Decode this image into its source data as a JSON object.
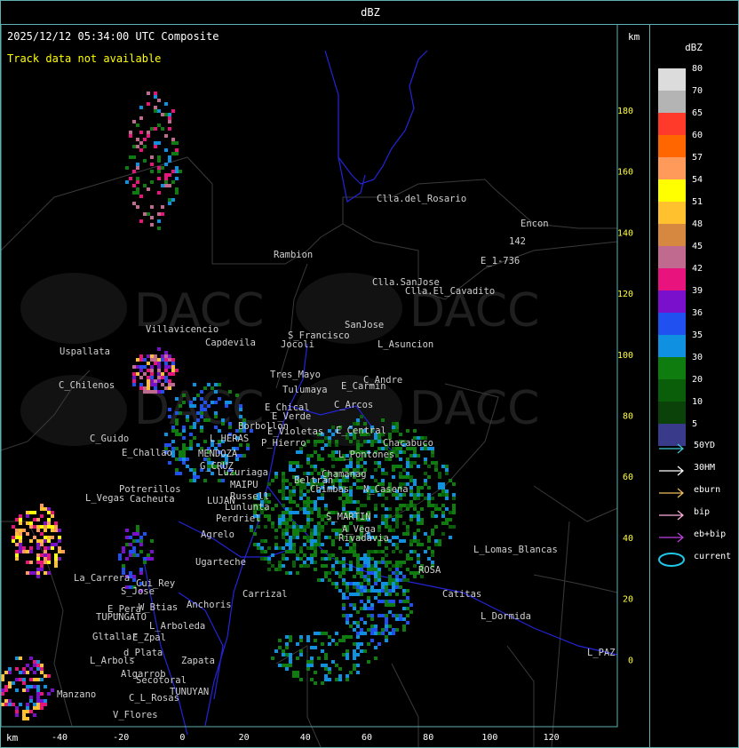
{
  "header": {
    "title": "dBZ"
  },
  "map": {
    "timestamp": "2025/12/12 05:34:00 UTC Composite",
    "track_status": "Track data not available",
    "unit_top": "km",
    "unit_bottom": "km",
    "y_ticks": [
      "180",
      "160",
      "140",
      "120",
      "100",
      "80",
      "60",
      "40",
      "20",
      "0"
    ],
    "x_ticks": [
      "-40",
      "-20",
      "0",
      "20",
      "40",
      "60",
      "80",
      "100",
      "120"
    ],
    "watermark": "DACC",
    "places": [
      "Clla.del_Rosario",
      "Encon",
      "142",
      "E_1-736",
      "Rambion",
      "Clla.SanJose",
      "Clla.El_Cavadito",
      "S_Francisco",
      "SanJose",
      "L_Asuncion",
      "Villavicencio",
      "Capdevila",
      "Uspallata",
      "Jocoli",
      "Tres_Mayo",
      "Tulumaya",
      "C_Andre",
      "E_Carmin",
      "C_Chilenos",
      "E_Chical",
      "E_Verde",
      "C_Arcos",
      "E_Violetas",
      "E_Central",
      "Borbollon",
      "P_Hierro",
      "L_HERAS",
      "C_Guido",
      "E_Challao",
      "MENDOZA",
      "G_CRUZ",
      "Luzuriaga",
      "Beltran",
      "Chimbas",
      "Chamanag",
      "L_Pontones",
      "Chacabuco",
      "MAIPU",
      "Russell",
      "Potrerillos",
      "L_Vegas",
      "Cacheuta",
      "LUJAN",
      "Lunlunta",
      "N_Casena",
      "S_MARTIN",
      "Perdriel",
      "Rivadavia",
      "Agrelo",
      "Ugarteche",
      "A_Vega",
      "L_Lomas_Blancas",
      "La_Carrera",
      "Cui_Rey",
      "S_Jose",
      "Carrizal",
      "ROSA",
      "Catitas",
      "E_Pera",
      "W_Btias",
      "Anchoris",
      "TUPUNGATO",
      "L_Arboleda",
      "L_Dormida",
      "Gltallar",
      "E_Zpal",
      "d_Plata",
      "Zapata",
      "L_Arbols",
      "L_PAZ",
      "Algarrob",
      "Secotoral",
      "Manzano",
      "TUNUYAN",
      "C_L_Rosas",
      "V_Flores"
    ]
  },
  "legend": {
    "title": "dBZ",
    "levels": [
      {
        "label": "80",
        "color": "#dcdcdc"
      },
      {
        "label": "70",
        "color": "#b4b4b4"
      },
      {
        "label": "65",
        "color": "#ff3a2a"
      },
      {
        "label": "60",
        "color": "#ff6600"
      },
      {
        "label": "57",
        "color": "#ff9a5a"
      },
      {
        "label": "54",
        "color": "#ffff00"
      },
      {
        "label": "51",
        "color": "#ffc22e"
      },
      {
        "label": "48",
        "color": "#d68840"
      },
      {
        "label": "45",
        "color": "#c06a90"
      },
      {
        "label": "42",
        "color": "#e8137d"
      },
      {
        "label": "39",
        "color": "#7a10cc"
      },
      {
        "label": "36",
        "color": "#2050f0"
      },
      {
        "label": "35",
        "color": "#1090e0"
      },
      {
        "label": "30",
        "color": "#0e7c0e"
      },
      {
        "label": "20",
        "color": "#0a5e0a"
      },
      {
        "label": "10",
        "color": "#0a420a"
      },
      {
        "label": "5",
        "color": "#3a3a8a"
      }
    ],
    "tracks": [
      {
        "label": "50YD",
        "color": "#40c8d8"
      },
      {
        "label": "30HM",
        "color": "#ffffff"
      },
      {
        "label": "eburn",
        "color": "#f0c060"
      },
      {
        "label": "bip",
        "color": "#ffb0e0"
      },
      {
        "label": "eb+bip",
        "color": "#c040e0"
      },
      {
        "label": "current",
        "color": "#20c8e8"
      }
    ]
  }
}
